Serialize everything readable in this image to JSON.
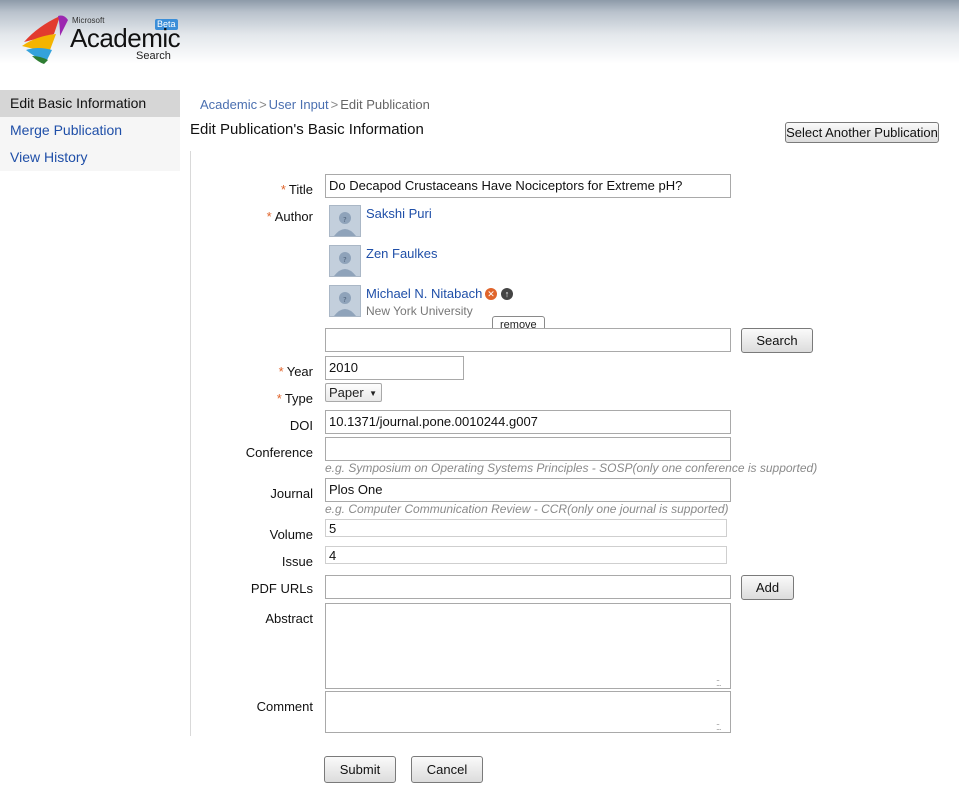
{
  "brand": {
    "microsoft": "Microsoft",
    "academic": "Academic",
    "search": "Search",
    "beta": "Beta"
  },
  "sidebar": {
    "items": [
      {
        "label": "Edit Basic Information"
      },
      {
        "label": "Merge Publication"
      },
      {
        "label": "View History"
      }
    ]
  },
  "breadcrumb": {
    "items": [
      "Academic",
      "User Input",
      "Edit Publication"
    ],
    "separator": ">"
  },
  "page": {
    "title": "Edit Publication's Basic Information",
    "select_another_label": "Select Another Publication"
  },
  "form": {
    "required_mark": "*",
    "title": {
      "label": "Title",
      "value": "Do Decapod Crustaceans Have Nociceptors for Extreme pH?"
    },
    "author": {
      "label": "Author",
      "authors": [
        {
          "name": "Sakshi Puri",
          "affiliation": ""
        },
        {
          "name": "Zen Faulkes",
          "affiliation": ""
        },
        {
          "name": "Michael N. Nitabach",
          "affiliation": "New York University"
        }
      ],
      "remove_tooltip": "remove",
      "search_value": "",
      "search_label": "Search"
    },
    "year": {
      "label": "Year",
      "value": "2010"
    },
    "type": {
      "label": "Type",
      "value": "Paper"
    },
    "doi": {
      "label": "DOI",
      "value": "10.1371/journal.pone.0010244.g007"
    },
    "conference": {
      "label": "Conference",
      "value": "",
      "hint": "e.g. Symposium on Operating Systems Principles - SOSP(only one conference is supported)"
    },
    "journal": {
      "label": "Journal",
      "value": "Plos One",
      "hint": "e.g. Computer Communication Review - CCR(only one journal is supported)"
    },
    "volume": {
      "label": "Volume",
      "value": "5"
    },
    "issue": {
      "label": "Issue",
      "value": "4"
    },
    "pdf_urls": {
      "label": "PDF URLs",
      "value": "",
      "add_label": "Add"
    },
    "abstract": {
      "label": "Abstract",
      "value": ""
    },
    "comment": {
      "label": "Comment",
      "value": ""
    },
    "submit_label": "Submit",
    "cancel_label": "Cancel"
  },
  "colors": {
    "link": "#1f4fa8",
    "required": "#e0642b",
    "hint": "#8a8a8a"
  },
  "icons": [
    "academic-search-logo",
    "remove-author-icon",
    "move-up-icon",
    "default-avatar-icon",
    "dropdown-arrow-icon",
    "resize-grip-icon"
  ]
}
